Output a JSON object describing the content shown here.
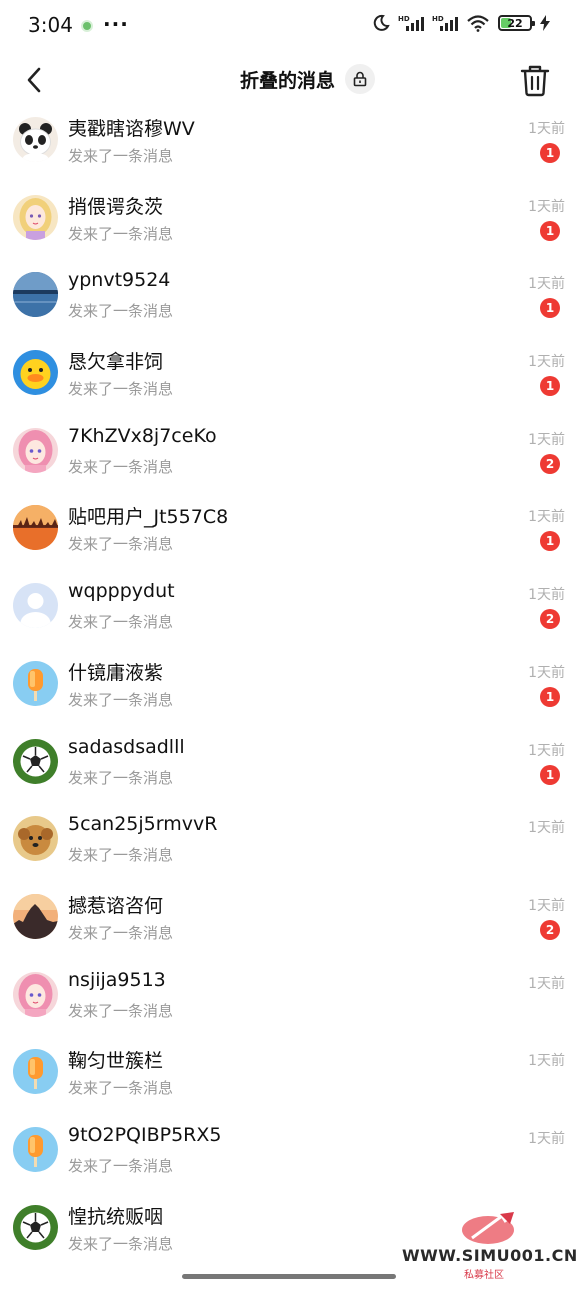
{
  "status_bar": {
    "time": "3:04",
    "more": "···",
    "battery": "22",
    "network_labels": [
      "HD",
      "HD"
    ]
  },
  "header": {
    "title": "折叠的消息"
  },
  "messages": [
    {
      "name": "夷戳瞎谘穆WV",
      "preview": "发来了一条消息",
      "time": "1天前",
      "badge": "1",
      "avatar": "panda"
    },
    {
      "name": "捎偎谔灸茨",
      "preview": "发来了一条消息",
      "time": "1天前",
      "badge": "1",
      "avatar": "blonde-girl"
    },
    {
      "name": "ypnvt9524",
      "preview": "发来了一条消息",
      "time": "1天前",
      "badge": "1",
      "avatar": "lake"
    },
    {
      "name": "恳欠拿非饲",
      "preview": "发来了一条消息",
      "time": "1天前",
      "badge": "1",
      "avatar": "duck"
    },
    {
      "name": "7KhZVx8j7ceKo",
      "preview": "发来了一条消息",
      "time": "1天前",
      "badge": "2",
      "avatar": "pink-girl"
    },
    {
      "name": "贴吧用户_Jt557C8",
      "preview": "发来了一条消息",
      "time": "1天前",
      "badge": "1",
      "avatar": "sunset"
    },
    {
      "name": "wqpppydut",
      "preview": "发来了一条消息",
      "time": "1天前",
      "badge": "2",
      "avatar": "default-user"
    },
    {
      "name": "什镜庸液紫",
      "preview": "发来了一条消息",
      "time": "1天前",
      "badge": "1",
      "avatar": "popsicle"
    },
    {
      "name": "sadasdsadlll",
      "preview": "发来了一条消息",
      "time": "1天前",
      "badge": "1",
      "avatar": "soccer"
    },
    {
      "name": "5can25j5rmvvR",
      "preview": "发来了一条消息",
      "time": "1天前",
      "badge": "",
      "avatar": "dog"
    },
    {
      "name": "撼惹谘咨何",
      "preview": "发来了一条消息",
      "time": "1天前",
      "badge": "2",
      "avatar": "dusk-city"
    },
    {
      "name": "nsjija9513",
      "preview": "发来了一条消息",
      "time": "1天前",
      "badge": "",
      "avatar": "pink-girl"
    },
    {
      "name": "鞠匀世簇栏",
      "preview": "发来了一条消息",
      "time": "1天前",
      "badge": "",
      "avatar": "popsicle"
    },
    {
      "name": "9tO2PQIBP5RX5",
      "preview": "发来了一条消息",
      "time": "1天前",
      "badge": "",
      "avatar": "popsicle"
    },
    {
      "name": "惶抗统贩咽",
      "preview": "发来了一条消息",
      "time": "",
      "badge": "",
      "avatar": "soccer"
    }
  ],
  "watermark": {
    "text": "WWW.SIMU001.CN",
    "sub": "私募社区"
  },
  "colors": {
    "badge": "#ee3a33",
    "muted_text": "#9a9a9a",
    "time_text": "#b0b0b0"
  }
}
